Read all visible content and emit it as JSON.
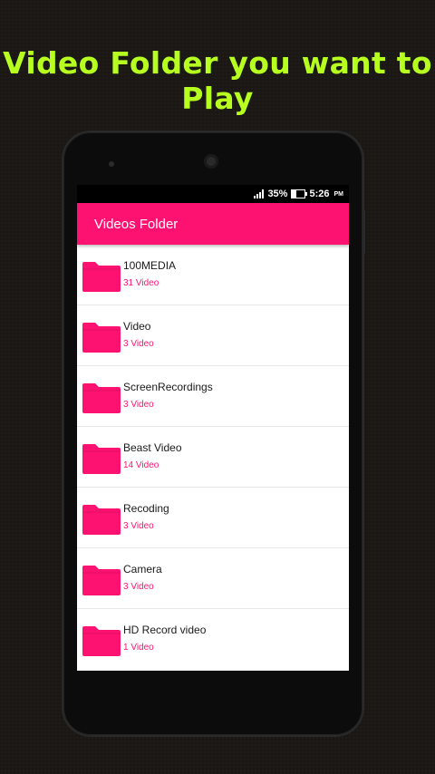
{
  "headline": "Video Folder you want to Play",
  "status": {
    "battery": "35%",
    "time": "5:26",
    "ampm": "PM"
  },
  "appbar": {
    "title": "Videos Folder"
  },
  "colors": {
    "accent": "#fe1271",
    "headline": "#b6ff1f"
  },
  "folders": [
    {
      "name": "100MEDIA",
      "count": "31 Video"
    },
    {
      "name": "Video",
      "count": "3 Video"
    },
    {
      "name": "ScreenRecordings",
      "count": "3 Video"
    },
    {
      "name": "Beast Video",
      "count": "14 Video"
    },
    {
      "name": "Recoding",
      "count": "3 Video"
    },
    {
      "name": "Camera",
      "count": "3 Video"
    },
    {
      "name": "HD Record video",
      "count": "1 Video"
    }
  ]
}
